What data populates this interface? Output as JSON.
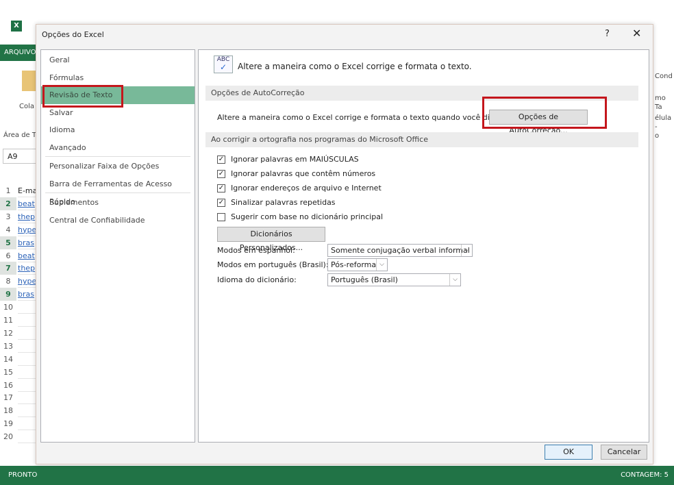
{
  "excel": {
    "arquivo_tab": "ARQUIVO",
    "paste_label": "Cola",
    "clipboard_label": "Área de T",
    "name_box": "A9",
    "right_ribbon": [
      "Cond",
      "mo Ta",
      "élula -",
      "o"
    ],
    "rows": [
      "1",
      "2",
      "3",
      "4",
      "5",
      "6",
      "7",
      "8",
      "9",
      "10",
      "11",
      "12",
      "13",
      "14",
      "15",
      "16",
      "17",
      "18",
      "19",
      "20"
    ],
    "selected_rows": [
      "2",
      "5",
      "7",
      "9"
    ],
    "cells": [
      "E-ma",
      "beat",
      "thep",
      "hype",
      "bras",
      "beat",
      "thep",
      "hype",
      "bras"
    ],
    "status_left": "PRONTO",
    "status_right": "CONTAGEM: 5"
  },
  "dialog": {
    "title": "Opções do Excel",
    "help": "?",
    "close": "✕",
    "nav": [
      {
        "label": "Geral"
      },
      {
        "label": "Fórmulas"
      },
      {
        "label": "Revisão de Texto",
        "active": true
      },
      {
        "label": "Salvar"
      },
      {
        "label": "Idioma"
      },
      {
        "label": "Avançado"
      },
      {
        "label": "Personalizar Faixa de Opções"
      },
      {
        "label": "Barra de Ferramentas de Acesso Rápido"
      },
      {
        "label": "Suplementos"
      },
      {
        "label": "Central de Confiabilidade"
      }
    ],
    "header_icon": "abc-check-icon",
    "header_text": "Altere a maneira como o Excel corrige e formata o texto.",
    "autocorrect_section": "Opções de AutoCorreção",
    "autocorrect_desc": "Altere a maneira como o Excel corrige e formata o texto quando você digita:",
    "autocorrect_button": "Opções de AutoCorreção...",
    "spelling_section": "Ao corrigir a ortografia nos programas do Microsoft Office",
    "checkboxes": [
      {
        "label": "Ignorar palavras em MAIÚSCULAS",
        "checked": true
      },
      {
        "label": "Ignorar palavras que contêm números",
        "checked": true
      },
      {
        "label": "Ignorar endereços de arquivo e Internet",
        "checked": true
      },
      {
        "label": "Sinalizar palavras repetidas",
        "checked": true
      },
      {
        "label": "Sugerir com base no dicionário principal",
        "checked": false
      }
    ],
    "custom_dict_button": "Dicionários Personalizados...",
    "spanish_label": "Modos em espanhol:",
    "spanish_value": "Somente conjugação verbal informal",
    "portuguese_label": "Modos em português (Brasil):",
    "portuguese_value": "Pós-reforma",
    "dict_lang_label": "Idioma do dicionário:",
    "dict_lang_value": "Português (Brasil)",
    "ok": "OK",
    "cancel": "Cancelar",
    "highlight_color": "#c4161c",
    "accent_color": "#217346"
  }
}
